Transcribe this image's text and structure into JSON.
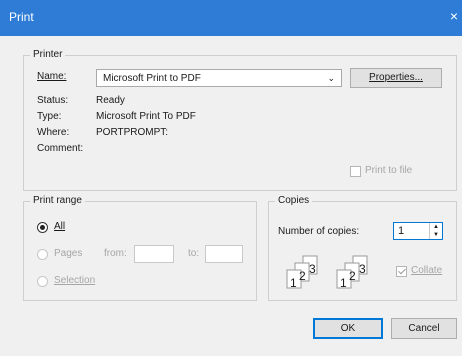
{
  "window": {
    "title": "Print",
    "close_glyph": "×"
  },
  "printer": {
    "group_label": "Printer",
    "name_label": "Name:",
    "name_value": "Microsoft Print to PDF",
    "properties_button": "Properties...",
    "status_label": "Status:",
    "status_value": "Ready",
    "type_label": "Type:",
    "type_value": "Microsoft Print To PDF",
    "where_label": "Where:",
    "where_value": "PORTPROMPT:",
    "comment_label": "Comment:",
    "print_to_file_label": "Print to file"
  },
  "print_range": {
    "group_label": "Print range",
    "all_label": "All",
    "pages_label": "Pages",
    "from_label": "from:",
    "to_label": "to:",
    "selection_label": "Selection"
  },
  "copies": {
    "group_label": "Copies",
    "number_label": "Number of copies:",
    "number_value": "1",
    "collate_label": "Collate",
    "collate_checked": true,
    "page_numbers": [
      "1",
      "2",
      "3"
    ]
  },
  "footer": {
    "ok_label": "OK",
    "cancel_label": "Cancel"
  },
  "colors": {
    "titlebar": "#2e7cd6",
    "focus": "#0078d7",
    "dialog_bg": "#f0f0f0"
  },
  "icons": [
    "close-icon",
    "chevron-down-icon",
    "spinner-arrows-icon",
    "collate-icon"
  ]
}
